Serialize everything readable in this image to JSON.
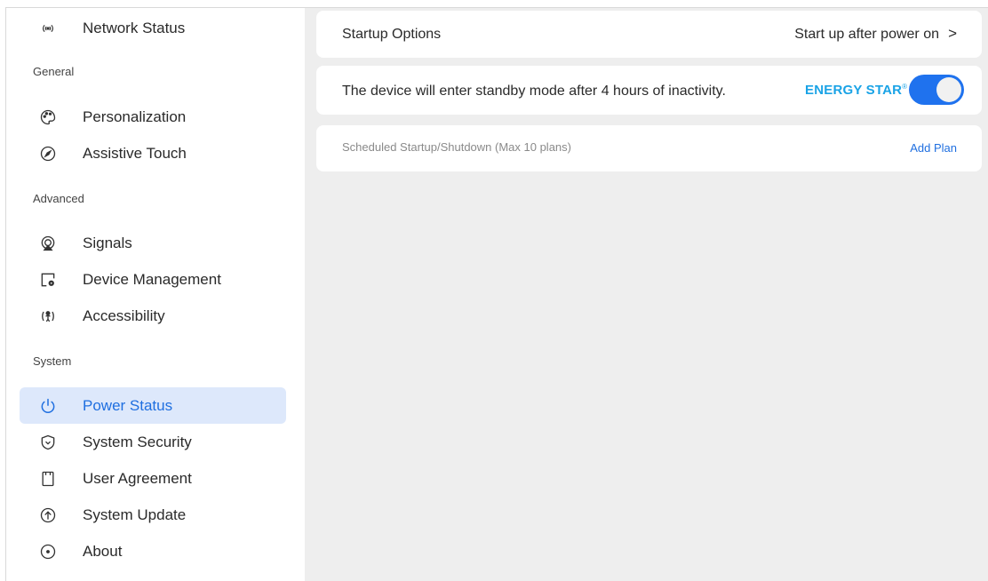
{
  "sidebar": {
    "top_item": {
      "label": "Network Status",
      "icon": "wifi-broadcast-icon"
    },
    "sections": [
      {
        "header": "General",
        "items": [
          {
            "label": "Personalization",
            "icon": "palette-icon"
          },
          {
            "label": "Assistive Touch",
            "icon": "compass-icon"
          }
        ]
      },
      {
        "header": "Advanced",
        "items": [
          {
            "label": "Signals",
            "icon": "signal-source-icon"
          },
          {
            "label": "Device Management",
            "icon": "device-settings-icon"
          },
          {
            "label": "Accessibility",
            "icon": "accessibility-icon"
          }
        ]
      },
      {
        "header": "System",
        "items": [
          {
            "label": "Power Status",
            "icon": "power-icon",
            "active": true
          },
          {
            "label": "System Security",
            "icon": "shield-icon"
          },
          {
            "label": "User Agreement",
            "icon": "document-icon"
          },
          {
            "label": "System Update",
            "icon": "upload-icon"
          },
          {
            "label": "About",
            "icon": "info-dot-icon"
          }
        ]
      }
    ]
  },
  "main": {
    "startup": {
      "label": "Startup Options",
      "value": "Start up after power on",
      "chevron": ">"
    },
    "standby": {
      "text": "The device will enter standby mode after 4 hours of inactivity.",
      "badge": "ENERGY STAR",
      "badge_mark": "®",
      "toggle_on": true
    },
    "schedule": {
      "label": "Scheduled Startup/Shutdown (Max 10 plans)",
      "action": "Add Plan"
    }
  },
  "colors": {
    "accent": "#1f6fe0",
    "active_bg": "#dde8fb",
    "energy_star": "#1aa3e6",
    "panel_bg": "#eeeeee"
  }
}
